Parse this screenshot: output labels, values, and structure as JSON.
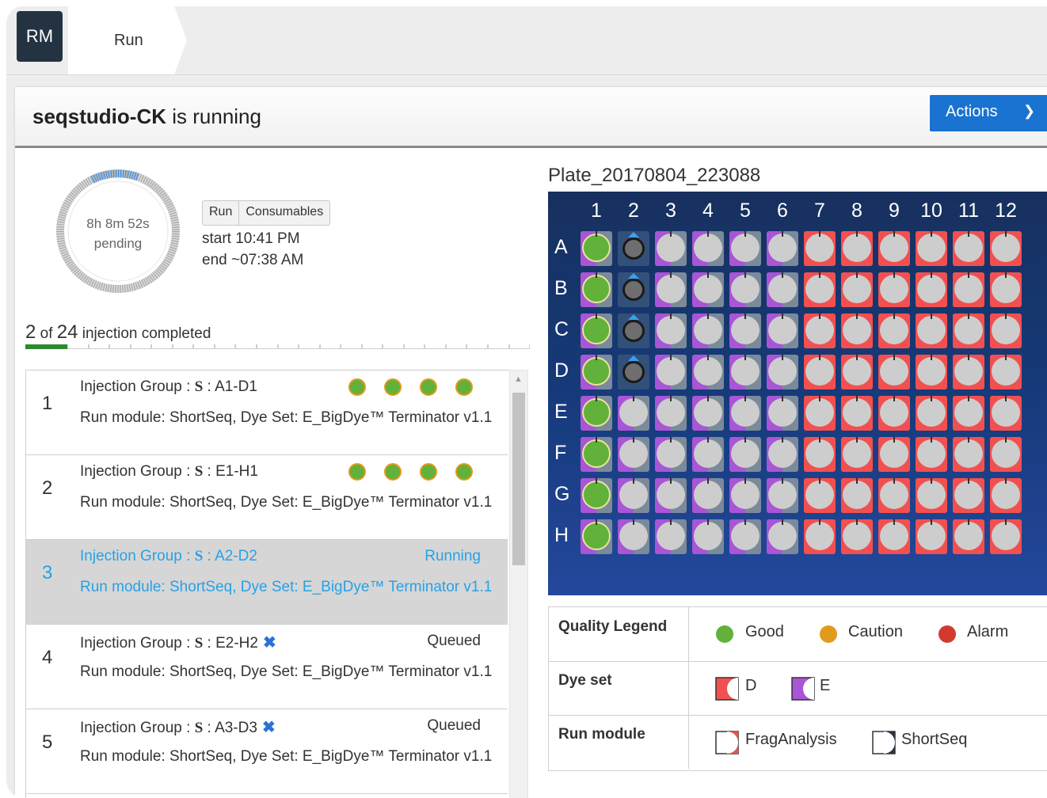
{
  "app": {
    "logo": "RM",
    "tab_label": "Run"
  },
  "header": {
    "instrument": "seqstudio-CK",
    "status_text": "is running",
    "actions_label": "Actions"
  },
  "run_status": {
    "elapsed": "8h 8m 52s",
    "state": "pending",
    "tab_run": "Run",
    "tab_consumables": "Consumables",
    "start": "start 10:41 PM",
    "end": "end ~07:38 AM",
    "completed_count": "2",
    "of_text": " of ",
    "total_count": "24",
    "progress_suffix": " injection completed",
    "completed_fraction": 0.0833
  },
  "injections": [
    {
      "num": "1",
      "group_prefix": "Injection Group : ",
      "group_letter": "S",
      "group_range": " : A1-D1",
      "status": "",
      "module": "Run module: ShortSeq, Dye Set: E_BigDye™ Terminator v1.1",
      "quality": [
        "good",
        "good",
        "good",
        "good"
      ]
    },
    {
      "num": "2",
      "group_prefix": "Injection Group : ",
      "group_letter": "S",
      "group_range": " : E1-H1",
      "status": "",
      "module": "Run module: ShortSeq, Dye Set: E_BigDye™ Terminator v1.1",
      "quality": [
        "good",
        "good",
        "good",
        "good"
      ]
    },
    {
      "num": "3",
      "group_prefix": "Injection Group : ",
      "group_letter": "S",
      "group_range": " : A2-D2",
      "status": "Running",
      "module": "Run module: ShortSeq, Dye Set: E_BigDye™ Terminator v1.1",
      "quality": []
    },
    {
      "num": "4",
      "group_prefix": "Injection Group : ",
      "group_letter": "S",
      "group_range": " : E2-H2",
      "status": "Queued",
      "module": "Run module: ShortSeq, Dye Set: E_BigDye™ Terminator v1.1",
      "quality": []
    },
    {
      "num": "5",
      "group_prefix": "Injection Group : ",
      "group_letter": "S",
      "group_range": " : A3-D3",
      "status": "Queued",
      "module": "Run module: ShortSeq, Dye Set: E_BigDye™ Terminator v1.1",
      "quality": []
    }
  ],
  "plate": {
    "name": "Plate_20170804_223088",
    "columns": [
      "1",
      "2",
      "3",
      "4",
      "5",
      "6",
      "7",
      "8",
      "9",
      "10",
      "11",
      "12"
    ],
    "rows": [
      "A",
      "B",
      "C",
      "D",
      "E",
      "F",
      "G",
      "H"
    ],
    "column_dye_set": [
      "E",
      "E",
      "E",
      "E",
      "E",
      "E",
      "D",
      "D",
      "D",
      "D",
      "D",
      "D"
    ],
    "well_states": {
      "col1_rows_A_D": "good",
      "col1_rows_E_H": "good",
      "col2_rows_A_D": "running",
      "other": "empty"
    }
  },
  "legend": {
    "quality_label": "Quality Legend",
    "good": "Good",
    "caution": "Caution",
    "alarm": "Alarm",
    "dye_label": "Dye set",
    "dye_d": "D",
    "dye_e": "E",
    "module_label": "Run module",
    "module_frag": "FragAnalysis",
    "module_short": "ShortSeq"
  },
  "colors": {
    "good": "#62b13a",
    "caution": "#e19b1c",
    "alarm": "#d23a2f",
    "dye_d": "#f25050",
    "dye_e": "#a855d6",
    "accent": "#1a73d1",
    "running_text": "#27a1e6"
  }
}
